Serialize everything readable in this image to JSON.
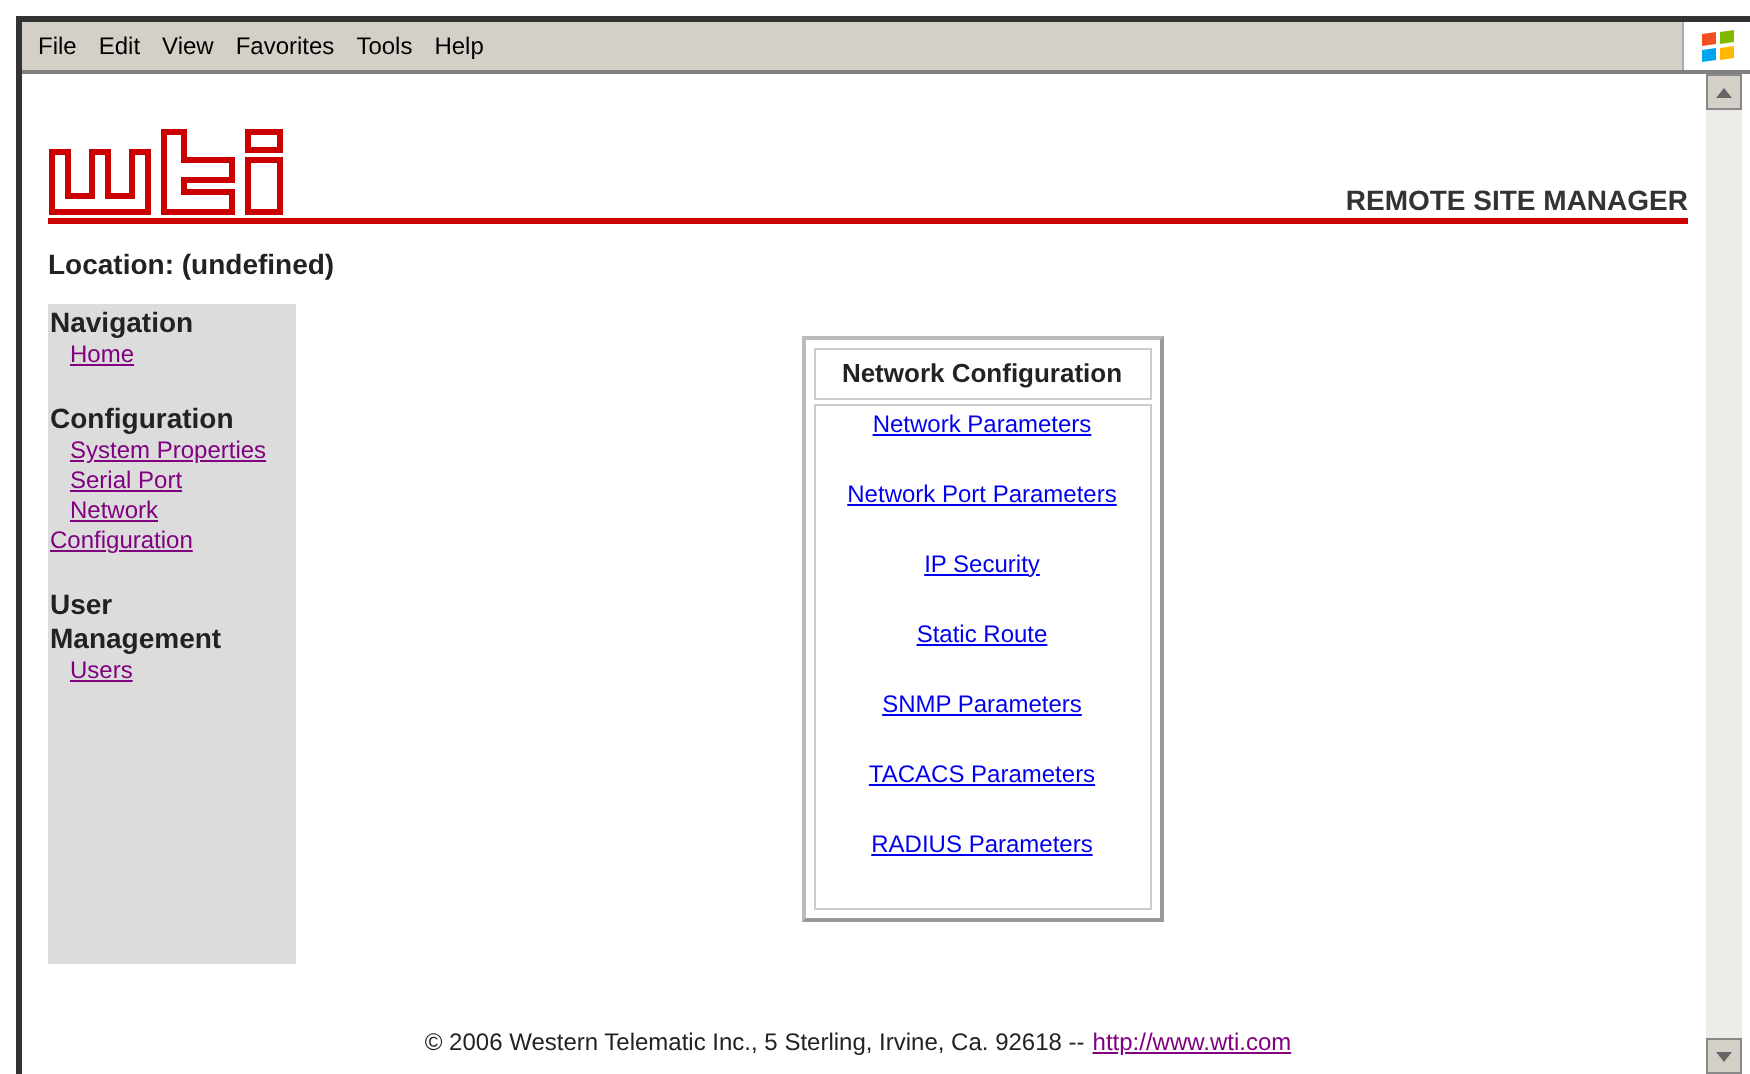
{
  "menu_bar": [
    "File",
    "Edit",
    "View",
    "Favorites",
    "Tools",
    "Help"
  ],
  "header": {
    "title": "REMOTE SITE MANAGER"
  },
  "location": "Location: (undefined)",
  "sidebar": {
    "sections": [
      {
        "title": "Navigation",
        "items": [
          {
            "label": "Home",
            "visited": true
          }
        ]
      },
      {
        "title": "Configuration",
        "items": [
          {
            "label": "System Properties",
            "visited": true
          },
          {
            "label": "Serial Port",
            "visited": true
          },
          {
            "label": "Network Configuration",
            "visited": true
          }
        ]
      },
      {
        "title": "User Management",
        "items": [
          {
            "label": "Users",
            "visited": true
          }
        ]
      }
    ]
  },
  "panel": {
    "title": "Network Configuration",
    "links": [
      {
        "label": "Network Parameters",
        "visited": false
      },
      {
        "label": "Network Port Parameters",
        "visited": false
      },
      {
        "label": "IP Security",
        "visited": false
      },
      {
        "label": "Static Route",
        "visited": false
      },
      {
        "label": "SNMP Parameters",
        "visited": false
      },
      {
        "label": "TACACS Parameters",
        "visited": false
      },
      {
        "label": "RADIUS Parameters",
        "visited": false
      }
    ]
  },
  "footer": {
    "text": "© 2006 Western Telematic Inc., 5 Sterling, Irvine, Ca. 92618 --",
    "link": {
      "label": "http://www.wti.com",
      "visited": true
    }
  }
}
